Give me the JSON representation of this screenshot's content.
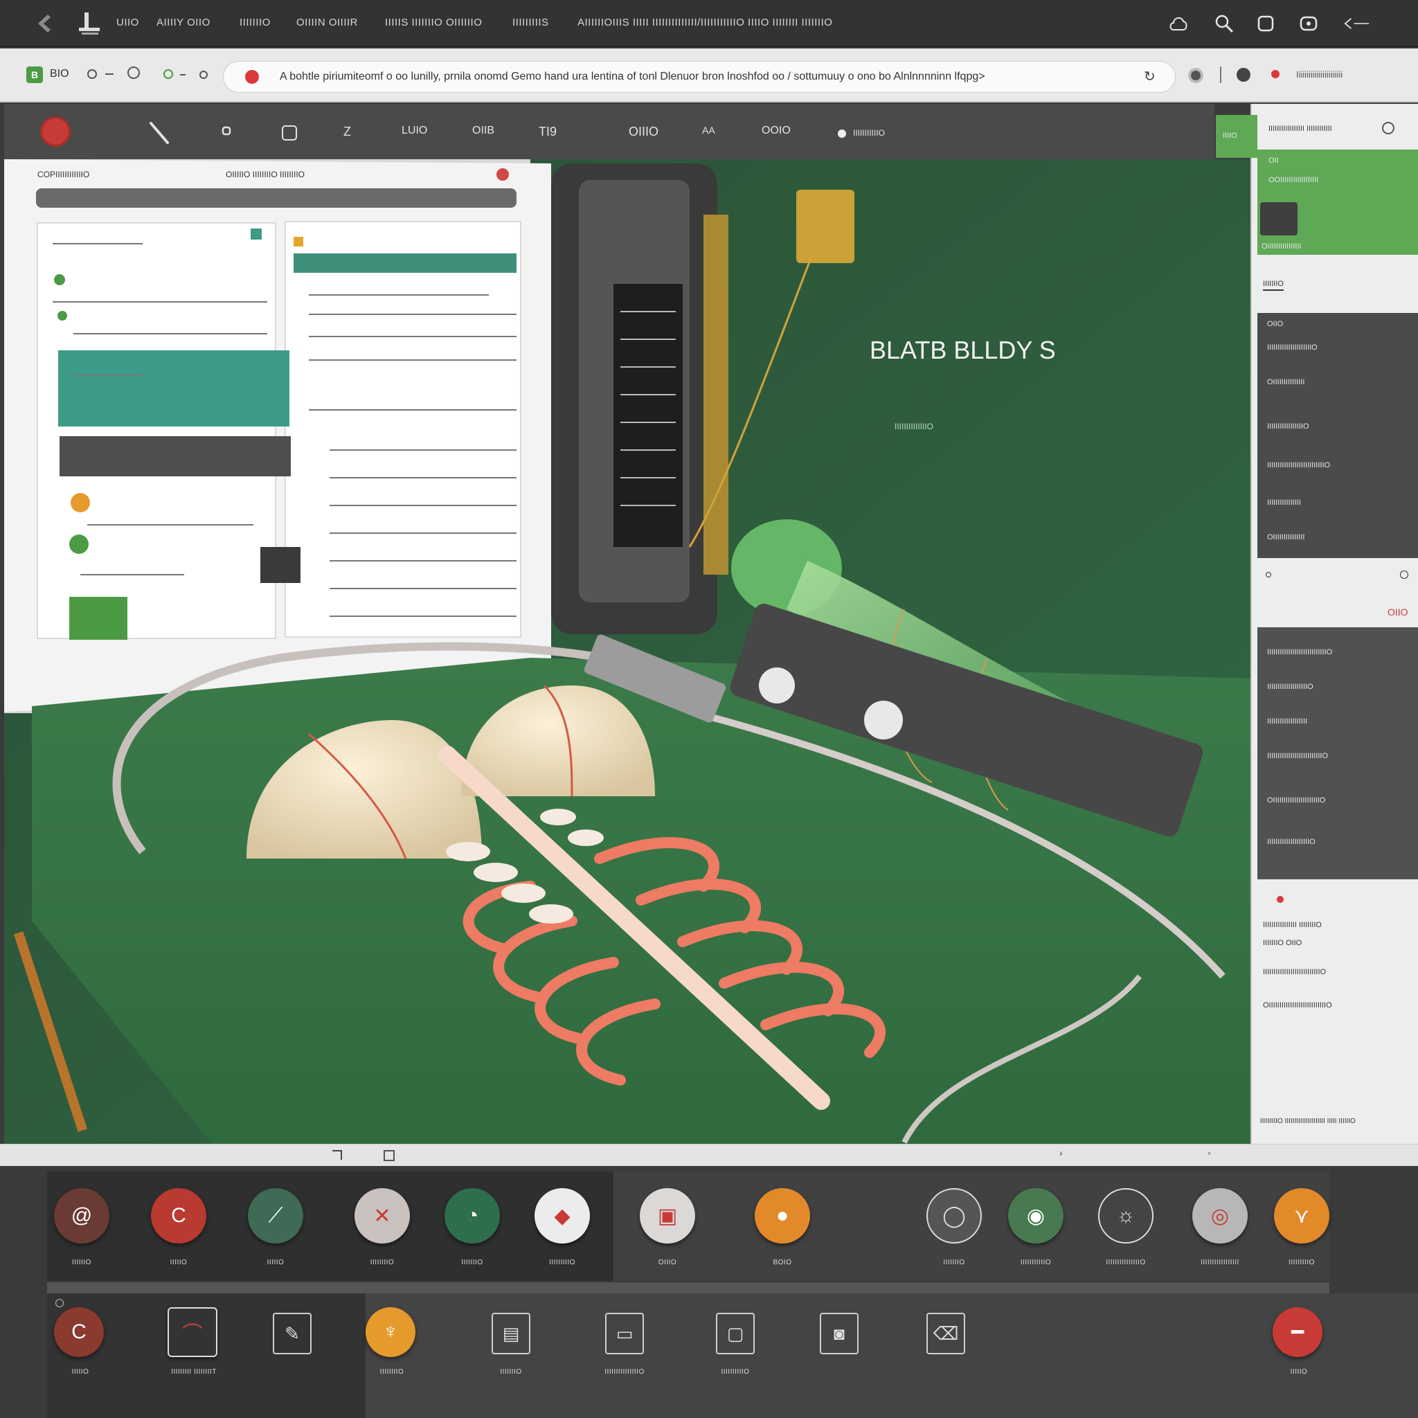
{
  "colors": {
    "accent_green": "#4d9a45",
    "record_red": "#c73a36",
    "scene_green": "#2f5a3c",
    "orange": "#e28a2a"
  },
  "menubar": {
    "back_icon": "chevron-left-icon",
    "app_icon": "anvil-icon",
    "items": [
      "UIIO",
      "AIIIIY OIIO",
      "IIIIIIIO",
      "OIIIIN  OIIIIR",
      "IIIIIS IIIIIIIO OIIIIIIO",
      "IIIIIIIIIS",
      "AIIIIIIOIIIS IIIII IIIIIIIIIIIIII/IIIIIIIIIIIO IIIIO IIIIIIII IIIIIIIO"
    ],
    "right_icons": [
      "cloud-icon",
      "search-icon",
      "window-icon",
      "mail-icon",
      "back-arrow-icon"
    ]
  },
  "address": {
    "badge": "B",
    "badge_label": "BIO",
    "url_text": "A bohtle piriumiteomf o oo lunilly, prnila onomd Gemo hand ura lentina of tonl Dlenuor bron lnoshfod oo / sottumuuy o ono bo Alnlnnnninn lfqpg>",
    "end_icon": "refresh-icon",
    "right_text": "Iiiiiiiiiiiiiiiiiiiiiii"
  },
  "toolbar": {
    "tools": [
      "pen-icon",
      "node-icon",
      "square-icon",
      "z-tool-icon"
    ],
    "labels": [
      "LUIO",
      "OIIB",
      "TI9",
      "OIIIO",
      "AA",
      "OOIO"
    ],
    "status": "IIIIIIIIIIIO"
  },
  "canvas": {
    "doc_header_left": "COPIIIIIIIIIIIIO",
    "doc_header_right": "OIIIIIO IIIIIIIIO IIIIIIIIO",
    "title": "BLATB BLLDY S",
    "subtitle": "IIIIIIIIIIIIIIO"
  },
  "rightpanel": {
    "header": "IIIIIIIIIIIIIIIII IIIIIIIIIIII",
    "tab_green": "IIIIO",
    "green_rows": [
      "OII",
      "OOIIIIIIIIIIIIIIIIII",
      "OIIIIIIIIIIIIIIII"
    ],
    "section1": "IIIIIIIO",
    "dark_rows": [
      "OIIO",
      "IIIIIIIIIIIIIIIIIIIIIO",
      "OIIIIIIIIIIIIIII",
      "IIIIIIIIIIIIIIIIIO",
      "IIIIIIIIIIIIIIIIIIIIIIIIIIIO",
      "IIIIIIIIIIIIIIII",
      "OIIIIIIIIIIIIIII"
    ],
    "red_label": "OIIO",
    "dark2_rows": [
      "IIIIIIIIIIIIIIIIIIIIIIIIIIIIO",
      "IIIIIIIIIIIIIIIIIIIO",
      "IIIIIIIIIIIIIIIIIII",
      "IIIIIIIIIIIIIIIIIIIIIIIIIIO",
      "OIIIIIIIIIIIIIIIIIIIIIIO",
      "IIIIIIIIIIIIIIIIIIIIO"
    ],
    "list_rows": [
      "IIIIIIIIIIIIIIII IIIIIIIIO",
      "IIIIIIIO OIIO",
      "IIIIIIIIIIIIIIIIIIIIIIIIIIIO",
      "OIIIIIIIIIIIIIIIIIIIIIIIIIIIO"
    ],
    "footer": "IIIIIIIIIO IIIIIIIIIIIIIIIIIIIII IIIII IIIIIIO"
  },
  "palette": {
    "row1": [
      {
        "label": "IIIIIIO",
        "color": "#6a3b34",
        "icon": "swirl-icon"
      },
      {
        "label": "IIIIIO",
        "color": "#b83a31",
        "icon": "hook-icon"
      },
      {
        "label": "IIIIIO",
        "color": "#3f6a55",
        "icon": "leaf-icon"
      },
      {
        "label": "IIIIIIIIO",
        "color": "#c9c2bf",
        "icon": "cross-icon"
      },
      {
        "label": "IIIIIIIO",
        "color": "#2f6e4c",
        "icon": "fan-icon"
      },
      {
        "label": "IIIIIIIIIO",
        "color": "#ececec",
        "icon": "shard-icon"
      },
      {
        "label": "OIIIO",
        "color": "#dcd8d6",
        "icon": "cube-icon"
      },
      {
        "label": "BOIO",
        "color": "#e28a2a",
        "icon": "sphere-icon"
      },
      {
        "label": "IIIIIIIO",
        "color": "#555555",
        "icon": "ring-icon"
      },
      {
        "label": "IIIIIIIIIIIO",
        "color": "#477a51",
        "icon": "eye-icon"
      },
      {
        "label": "IIIIIIIIIIIIIIIO",
        "color": "#444444",
        "icon": "sun-icon"
      },
      {
        "label": "IIIIIIIIIIIIIIIII",
        "color": "#b7b7b7",
        "icon": "disc-icon"
      },
      {
        "label": "IIIIIIIIIO",
        "color": "#e28a2a",
        "icon": "bird-icon"
      }
    ],
    "row2": [
      {
        "label": "IIIIIO",
        "color": "#8a3a2f",
        "icon": "hook-icon"
      },
      {
        "label": "IIIIIIIII IIIIIIIIT",
        "color": "#b8463a",
        "icon": "brush-icon"
      },
      {
        "label": "",
        "color": "",
        "icon": "pen-icon"
      },
      {
        "label": "IIIIIIIIO",
        "color": "#e59a2c",
        "icon": "figure-icon"
      },
      {
        "label": "IIIIIIIO",
        "color": "",
        "icon": "camera-icon"
      },
      {
        "label": "IIIIIIIIIIIIIIIO",
        "color": "",
        "icon": "stand-icon"
      },
      {
        "label": "IIIIIIIIIIO",
        "color": "",
        "icon": "frame-icon"
      },
      {
        "label": "",
        "color": "",
        "icon": "speaker-icon"
      },
      {
        "label": "",
        "color": "",
        "icon": "eraser-icon"
      },
      {
        "label": "IIIIIO",
        "color": "#c73a36",
        "icon": "minus-icon"
      }
    ]
  }
}
